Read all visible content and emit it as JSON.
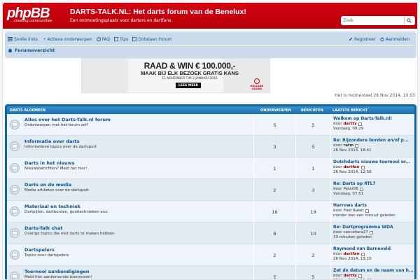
{
  "header": {
    "logo_text": "phpBB",
    "logo_sub": "creating communities",
    "title": "DARTS-TALK.NL: Het darts forum van de Benelux!",
    "description": "Een ontmoetingsplaats voor darters en dartfans",
    "search_placeholder": "Zoek",
    "brand_color": "#c8000b"
  },
  "nav": {
    "quick_links": "Snelle links",
    "active_topics": "Actieve onderwerpen",
    "faq": "FAQ",
    "tips": "Tips",
    "unanswered": "Ontstaan Forum",
    "register": "Registreer",
    "login": "Aanmelden",
    "breadcrumb": "Forumoverzicht"
  },
  "banner": {
    "line1": "RAAD & WIN € 100.000,-",
    "line2": "MAAK BIJ ELK BEZOEK GRATIS KANS",
    "line3": "11 NOVEMBER T/M 2 JANUARI 2015",
    "button": "LEES MEER",
    "logo": "HOLLAND CASINO"
  },
  "datetime": "Het is momenteel 28 Nov 2014, 10:03",
  "forum": {
    "headers": {
      "category": "DARTS ALGEMEEN",
      "topics": "ONDERWERPEN",
      "posts": "BERICHTEN",
      "last_post": "LAATSTE BERICHT"
    },
    "rows": [
      {
        "title": "Alles over het Darts-Talk.nl forum",
        "desc": "Onderwerpen met het forum zelf",
        "topics": "5",
        "posts": "5",
        "last_title": "Welkom op Darts-Talk.nl!",
        "by_label": "door",
        "user": "dartty",
        "user_style": "red",
        "date": "Vandaag, 09:29"
      },
      {
        "title": "Informatie over darts",
        "desc": "Informatieve topics over de dartsport",
        "topics": "3",
        "posts": "5",
        "last_title": "Re: Bijzondere borden en/of p...",
        "by_label": "door",
        "user": "ratm",
        "user_style": "bold",
        "date": "26 Nov 2014, 18:41"
      },
      {
        "title": "Darts in het nieuws",
        "desc": "Nieuwsberichten? Meld het hier!",
        "topics": "1",
        "posts": "1",
        "last_title": "Dutchdarts nieuwe toernooi or...",
        "by_label": "door",
        "user": "dartfan",
        "user_style": "red",
        "date": "26 Nov 2014, 12:58"
      },
      {
        "title": "Darts en de media",
        "desc": "Media artikelen over de dartsport",
        "topics": "2",
        "posts": "3",
        "last_title": "Re: Darts op RTL7",
        "by_label": "door",
        "user": "Peter06",
        "user_style": "plain",
        "date": "Vandaag, 07:51"
      },
      {
        "title": "Materiaal en techniek",
        "desc": "Dartpijlen, dartborden, gooitechnieken enz.",
        "topics": "16",
        "posts": "19",
        "last_title": "Harrows darts",
        "by_label": "door",
        "user": "Fred Raket",
        "user_style": "plain",
        "date": "minder dan een minuut geleden"
      },
      {
        "title": "Darts-Talk chat",
        "desc": "Overige topics die met darts te maken hebben",
        "topics": "8",
        "posts": "10",
        "last_title": "Re: Dartprogramma WDA",
        "by_label": "door",
        "user": "cancellara27",
        "user_style": "plain",
        "date": "33 minuten geleden"
      },
      {
        "title": "Dartspelers",
        "desc": "Topics over dartspelers",
        "topics": "2",
        "posts": "2",
        "last_title": "Raymond van Barneveld",
        "by_label": "door",
        "user": "dartfan",
        "user_style": "red",
        "date": "26 Nov 2014, 13:10"
      },
      {
        "title": "Toernooi aankondigingen",
        "desc": "Meld hier aankomende toernooien!",
        "topics": "5",
        "posts": "5",
        "last_title": "Zet de datum en de naam van h...",
        "by_label": "door",
        "user": "dartty",
        "user_style": "red",
        "date": "26 Nov 2014, 19:49"
      }
    ]
  }
}
